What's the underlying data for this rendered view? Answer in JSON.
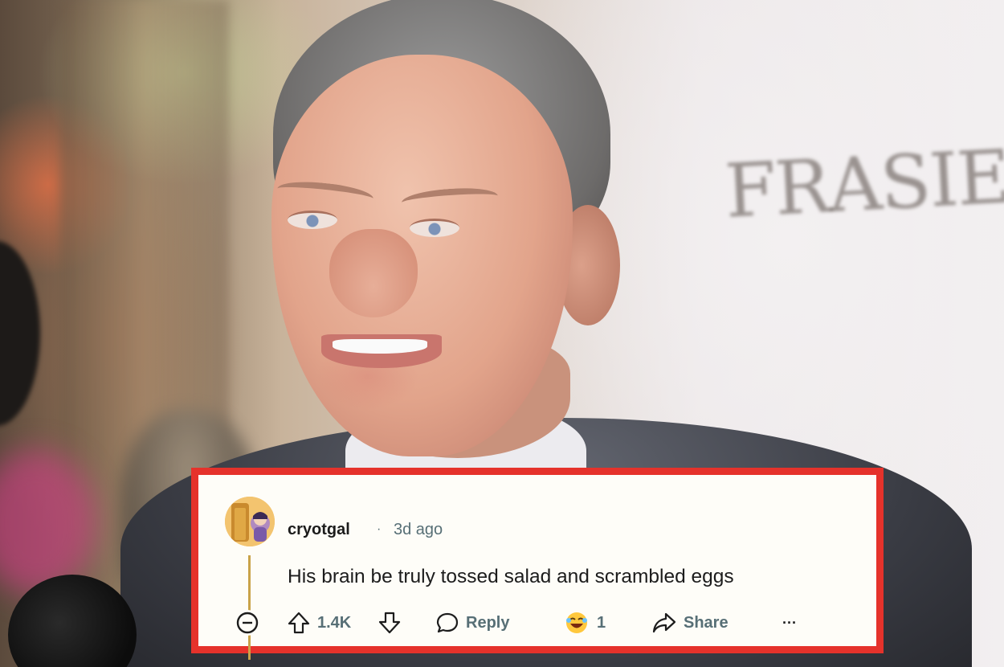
{
  "photo": {
    "backdrop_text": "FRASIER"
  },
  "comment": {
    "username": "cryotgal",
    "separator": "·",
    "time_ago": "3d ago",
    "text": "His brain be truly tossed salad and scrambled eggs",
    "vote_count": "1.4K",
    "reply_label": "Reply",
    "award_count": "1",
    "share_label": "Share",
    "more_label": "···"
  },
  "colors": {
    "frame_border": "#e5322b",
    "card_background": "#fefdf8",
    "thread_line": "#c9a349",
    "meta_text": "#576f76",
    "primary_text": "#1c1c1c"
  },
  "icons": {
    "avatar": "snoo-avatar-icon",
    "collapse": "collapse-minus-icon",
    "upvote": "upvote-arrow-icon",
    "downvote": "downvote-arrow-icon",
    "reply": "speech-bubble-icon",
    "award": "laughing-award-icon",
    "share": "share-arrow-icon",
    "more": "more-dots-icon"
  }
}
